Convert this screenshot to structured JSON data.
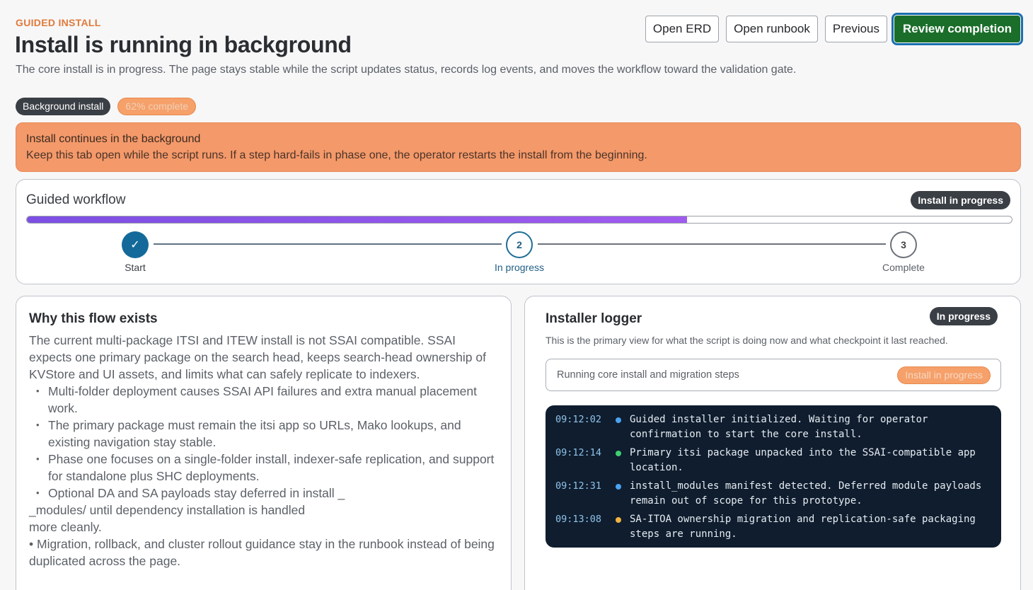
{
  "header": {
    "eyebrow": "GUIDED INSTALL",
    "title": "Install is running in background",
    "description": "The core install is in progress. The page stays stable while the script updates status, records log events, and moves the workflow toward the validation gate.",
    "chips": {
      "mode": "Background install",
      "progress": "62% complete",
      "progress_value": 0.62
    }
  },
  "actions": {
    "open_erd": "Open ERD",
    "open_runbook": "Open runbook",
    "previous": "Previous",
    "review_completion": "Review completion"
  },
  "alert": {
    "title": "Install continues in the background",
    "body": "Keep this tab open while the script runs. If a step hard-fails in phase one, the operator restarts the install from the beginning.",
    "color": "#f4996a"
  },
  "workflow": {
    "title": "Guided workflow",
    "badge": "Install in progress",
    "progress_value": 0.67,
    "steps": [
      {
        "marker": "✓",
        "label": "Start",
        "state": "done"
      },
      {
        "marker": "2",
        "label": "In progress",
        "state": "active"
      },
      {
        "marker": "3",
        "label": "Complete",
        "state": "todo"
      }
    ]
  },
  "why": {
    "title": "Why this flow exists",
    "intro": "The current multi-package ITSI and ITEW install is not SSAI compatible. SSAI expects one primary package on the search head, keeps search-head ownership of KVStore and UI assets, and limits what can safely replicate to indexers.",
    "bullets": [
      "Multi-folder deployment causes SSAI API failures and extra manual placement work.",
      "The primary package must remain the itsi app so URLs, Mako lookups, and existing navigation stay stable.",
      "Phase one focuses on a single-folder install, indexer-safe replication, and support for standalone plus SHC deployments.",
      "Optional DA and SA payloads stay deferred in install _"
    ],
    "continuation": "_modules/ until dependency installation is handled",
    "continuation2": "more cleanly.",
    "last": "• Migration, rollback, and cluster rollout guidance stay in the runbook instead of being duplicated across the page."
  },
  "logger": {
    "title": "Installer logger",
    "badge": "In progress",
    "subtitle": "This is the primary view for what the script is doing now and what checkpoint it last reached.",
    "status_text": "Running core install and migration steps",
    "status_chip": "Install in progress",
    "entries": [
      {
        "time": "09:12:02",
        "color": "#4aa3f0",
        "message": "Guided installer initialized. Waiting for operator confirmation to start the core install."
      },
      {
        "time": "09:12:14",
        "color": "#3ecf6e",
        "message": "Primary itsi package unpacked into the SSAI-compatible app location."
      },
      {
        "time": "09:12:31",
        "color": "#4aa3f0",
        "message": "install_modules manifest detected. Deferred module payloads remain out of scope for this prototype."
      },
      {
        "time": "09:13:08",
        "color": "#f2b340",
        "message": "SA-ITOA ownership migration and replication-safe packaging steps are running."
      }
    ]
  }
}
